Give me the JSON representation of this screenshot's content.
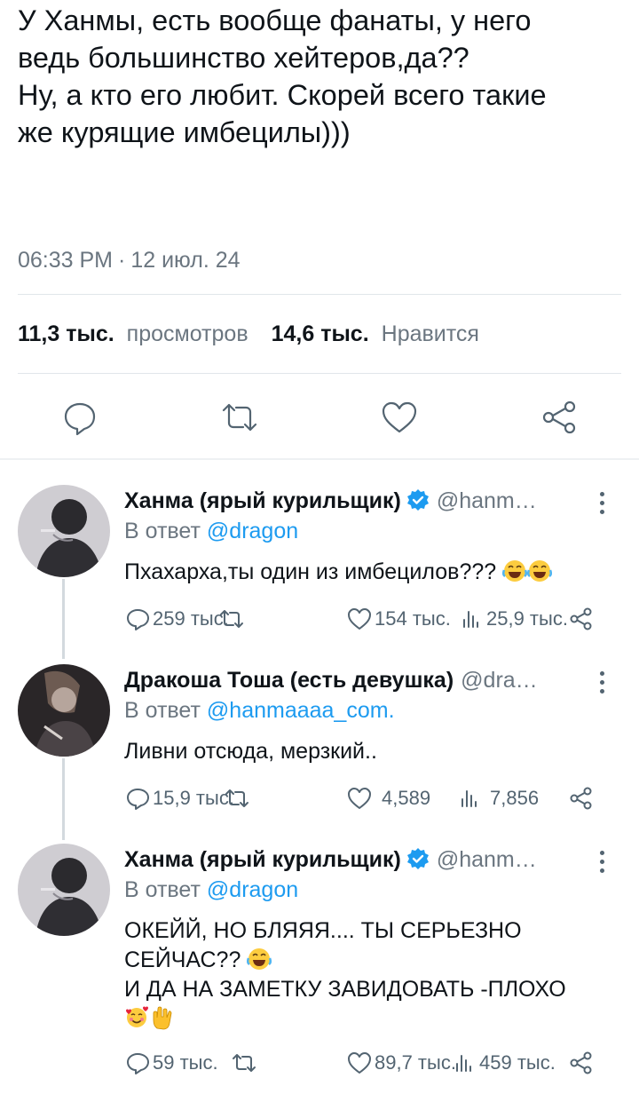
{
  "tweet": {
    "lines": [
      "У Ханмы, есть вообще фанаты, у него",
      "ведь большинство хейтеров,да??",
      "Ну, а кто его любит. Скорей всего такие",
      "же курящие имбецилы)))"
    ],
    "time": "06:33 PM",
    "separator": "·",
    "date": "12 июл. 24",
    "views_count": "11,3 тыс.",
    "views_label": "просмотров",
    "likes_count": "14,6 тыс.",
    "likes_label": "Нравится"
  },
  "replies": [
    {
      "name": "Ханма (ярый курильщик)",
      "verified": true,
      "handle": "@hanm…",
      "reply_to_label": "В ответ",
      "reply_to": "@dragon",
      "text_lines": [
        "Пхахарха,ты один из имбецилов???"
      ],
      "emojis": [
        "joy-emoji",
        "joy-emoji"
      ],
      "replies": "259 тыс.",
      "likes": "154 тыс.",
      "views": "25,9 тыс."
    },
    {
      "name": "Дракоша Тоша (есть девушка)",
      "verified": false,
      "handle": "@dra…",
      "reply_to_label": "В ответ",
      "reply_to": "@hanmaaaa_com.",
      "text_lines": [
        "Ливни отсюда, мерзкий.."
      ],
      "replies": "15,9 тыс.",
      "likes": "4,589",
      "views": "7,856"
    },
    {
      "name": "Ханма (ярый курильщик)",
      "verified": true,
      "handle": "@hanm…",
      "reply_to_label": "В ответ",
      "reply_to": "@dragon",
      "text_lines": [
        "ОКЕЙЙ, НО БЛЯЯЯ.... ТЫ СЕРЬЕЗНО",
        "СЕЙЧАС??",
        "И ДА НА ЗАМЕТКУ ЗАВИДОВАТЬ -ПЛОХО"
      ],
      "emojis": [
        "joy-emoji",
        "smiling-hearts-emoji",
        "rock-on-hand-emoji"
      ],
      "replies": "59 тыс.",
      "likes": "89,7 тыс.",
      "views": "459 тыс."
    }
  ],
  "colors": {
    "text": "#0f1419",
    "secondary": "#6b7680",
    "link": "#1d9bf0",
    "icon": "#536471",
    "divider": "#e1e6ea"
  }
}
